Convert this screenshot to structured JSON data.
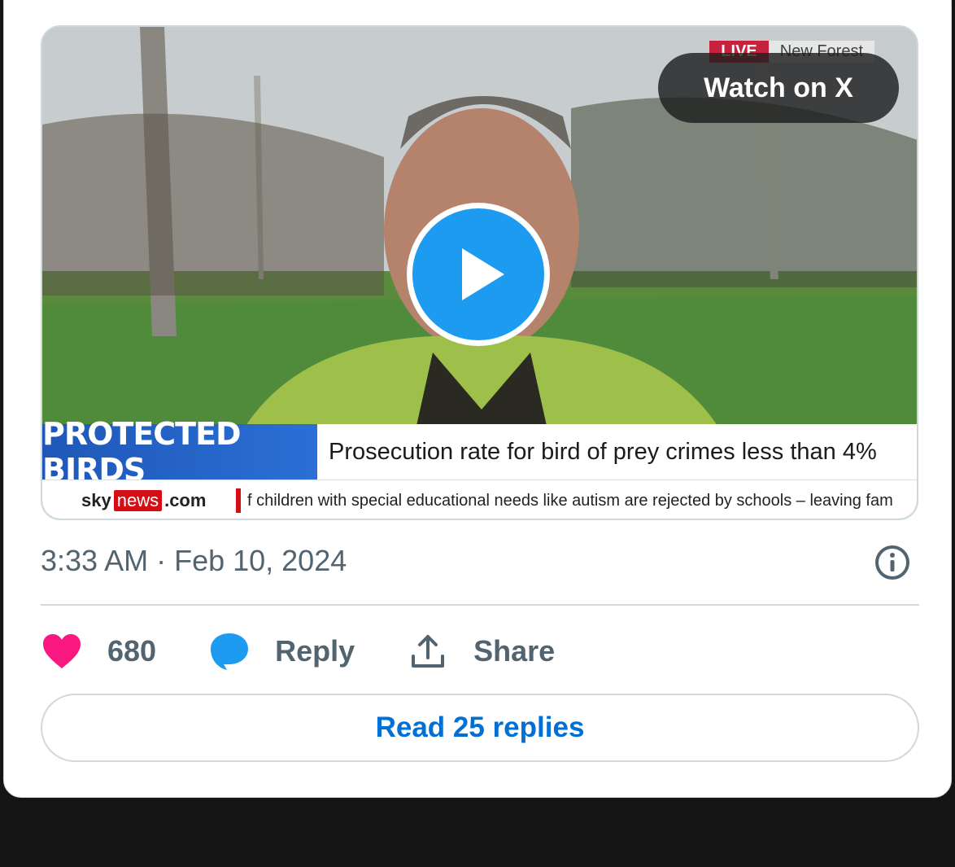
{
  "video": {
    "live_tag": "LIVE",
    "location": "New Forest",
    "watch_label": "Watch on X",
    "banner_label": "PROTECTED BIRDS",
    "headline": "Prosecution rate for bird of prey crimes less than 4%",
    "logo_sky": "sky",
    "logo_news": "news",
    "logo_com": ".com",
    "ticker": "f children with special educational needs like autism are rejected by schools – leaving fam"
  },
  "post": {
    "timestamp": "3:33 AM · Feb 10, 2024"
  },
  "actions": {
    "likes": "680",
    "reply_label": "Reply",
    "share_label": "Share"
  },
  "read_replies_label": "Read 25 replies",
  "colors": {
    "like": "#f91880",
    "reply": "#1d9bf0",
    "link": "#006fd6",
    "muted": "#536471"
  }
}
